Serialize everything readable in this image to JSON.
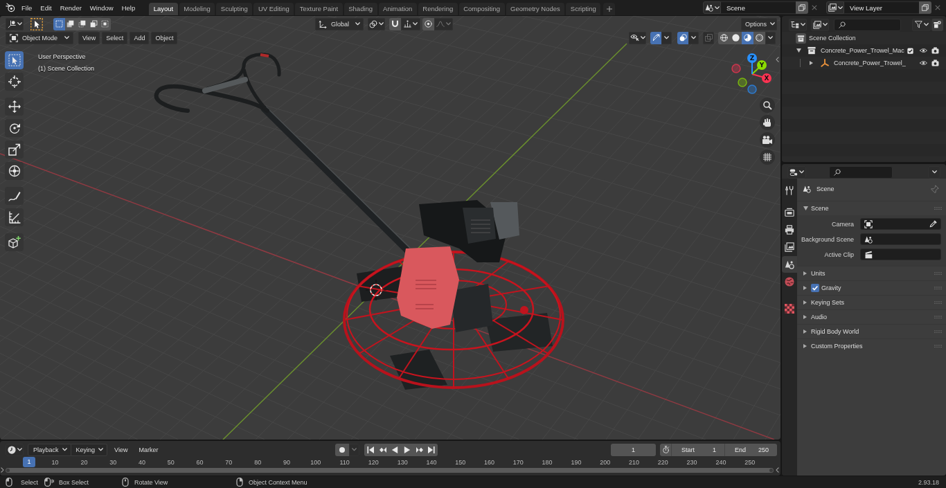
{
  "top_bar": {
    "menus": [
      "File",
      "Edit",
      "Render",
      "Window",
      "Help"
    ],
    "workspaces": [
      {
        "label": "Layout",
        "selected": true
      },
      {
        "label": "Modeling",
        "selected": false
      },
      {
        "label": "Sculpting",
        "selected": false
      },
      {
        "label": "UV Editing",
        "selected": false
      },
      {
        "label": "Texture Paint",
        "selected": false
      },
      {
        "label": "Shading",
        "selected": false
      },
      {
        "label": "Animation",
        "selected": false
      },
      {
        "label": "Rendering",
        "selected": false
      },
      {
        "label": "Compositing",
        "selected": false
      },
      {
        "label": "Geometry Nodes",
        "selected": false
      },
      {
        "label": "Scripting",
        "selected": false
      }
    ],
    "scene": "Scene",
    "view_layer": "View Layer"
  },
  "tool_header": {
    "select_modes": [
      {
        "selected": true
      },
      {
        "selected": false
      },
      {
        "selected": false
      },
      {
        "selected": false
      },
      {
        "selected": false
      }
    ],
    "orientation": "Global",
    "snap": {
      "on": false
    },
    "proportional": {
      "on": false
    },
    "options": "Options"
  },
  "viewport_header": {
    "mode": "Object Mode",
    "menus": [
      "View",
      "Select",
      "Add",
      "Object"
    ],
    "gizmos": {
      "on": true
    },
    "overlays": {
      "on": true
    },
    "xray": {
      "on": false
    },
    "shading_modes": [
      {
        "selected": false
      },
      {
        "selected": false
      },
      {
        "selected": true
      },
      {
        "selected": false
      }
    ]
  },
  "viewport": {
    "view_name": "User Perspective",
    "collection": "(1) Scene Collection",
    "tool_groups": [
      [
        {
          "selected": true
        },
        {
          "selected": false
        }
      ],
      [
        {
          "selected": false
        },
        {
          "selected": false
        },
        {
          "selected": false
        },
        {
          "selected": false
        }
      ],
      [
        {
          "selected": false
        },
        {
          "selected": false
        }
      ],
      [
        {
          "selected": false
        }
      ]
    ],
    "gizmo_axes": [
      {
        "label": "X",
        "color": "#ff3352"
      },
      {
        "label": "Y",
        "color": "#8bdc00"
      },
      {
        "label": "Z",
        "color": "#2890ff"
      }
    ]
  },
  "outliner": {
    "tree": [
      {
        "label": "Scene Collection",
        "kind": "scene_collection",
        "children": [
          {
            "label": "Concrete_Power_Trowel_Mac",
            "kind": "collection",
            "expanded": true,
            "checked": true,
            "visible": true,
            "renderable": true,
            "children": [
              {
                "label": "Concrete_Power_Trowel_",
                "kind": "empty",
                "expanded": false,
                "visible": true,
                "renderable": true
              }
            ]
          }
        ]
      }
    ]
  },
  "properties": {
    "tab_groups": [
      [
        {
          "selected": false
        }
      ],
      [
        {
          "selected": false
        },
        {
          "selected": false
        },
        {
          "selected": false
        },
        {
          "selected": true
        },
        {
          "selected": false
        }
      ],
      [
        {
          "selected": false
        }
      ]
    ],
    "context": "Scene",
    "sections": [
      {
        "title": "Scene",
        "kind": "plain",
        "expanded": true,
        "fields": [
          {
            "label": "Camera",
            "kind": "camera"
          },
          {
            "label": "Background Scene",
            "kind": "scene"
          },
          {
            "label": "Active Clip",
            "kind": "clip"
          }
        ]
      },
      {
        "title": "Units",
        "kind": "plain",
        "expanded": false
      },
      {
        "title": "Gravity",
        "kind": "toggle",
        "checked": true,
        "expanded": false
      },
      {
        "title": "Keying Sets",
        "kind": "plain",
        "expanded": false
      },
      {
        "title": "Audio",
        "kind": "plain",
        "expanded": false
      },
      {
        "title": "Rigid Body World",
        "kind": "plain",
        "expanded": false
      },
      {
        "title": "Custom Properties",
        "kind": "plain",
        "expanded": false
      }
    ]
  },
  "timeline": {
    "menus": [
      {
        "label": "Playback",
        "kind": "dropdown"
      },
      {
        "label": "Keying",
        "kind": "dropdown"
      },
      {
        "label": "View",
        "kind": "menu"
      },
      {
        "label": "Marker",
        "kind": "menu"
      }
    ],
    "auto_keying": {
      "on": false
    },
    "current_frame": "1",
    "start": {
      "label": "Start",
      "value": "1"
    },
    "end": {
      "label": "End",
      "value": "250"
    },
    "ruler": {
      "current": "1",
      "ticks": [
        "10",
        "20",
        "30",
        "40",
        "50",
        "60",
        "70",
        "80",
        "90",
        "100",
        "110",
        "120",
        "130",
        "140",
        "150",
        "160",
        "170",
        "180",
        "190",
        "200",
        "210",
        "220",
        "230",
        "240",
        "250"
      ]
    }
  },
  "status_bar": {
    "hints": [
      "Select",
      "Box Select",
      "Rotate View",
      "Object Context Menu"
    ],
    "version": "2.93.18"
  }
}
